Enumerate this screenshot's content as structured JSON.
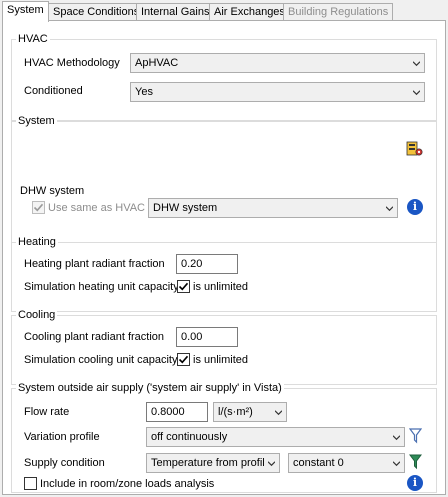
{
  "tabs": [
    {
      "label": "System",
      "active": true,
      "disabled": false
    },
    {
      "label": "Space Conditions",
      "active": false,
      "disabled": false
    },
    {
      "label": "Internal Gains",
      "active": false,
      "disabled": false
    },
    {
      "label": "Air Exchanges",
      "active": false,
      "disabled": false
    },
    {
      "label": "Building Regulations",
      "active": false,
      "disabled": true
    }
  ],
  "hvac": {
    "title": "HVAC",
    "methodology_label": "HVAC Methodology",
    "methodology_value": "ApHVAC",
    "conditioned_label": "Conditioned",
    "conditioned_value": "Yes"
  },
  "system": {
    "title": "System",
    "dhw_label": "DHW system",
    "use_same_label": "Use same as HVAC",
    "use_same_checked": true,
    "dhw_value": "DHW system"
  },
  "heating": {
    "title": "Heating",
    "radiant_label": "Heating plant radiant fraction",
    "radiant_value": "0.20",
    "capacity_label": "Simulation heating unit capacity",
    "unlimited_label": "is unlimited",
    "unlimited_checked": true
  },
  "cooling": {
    "title": "Cooling",
    "radiant_label": "Cooling plant radiant fraction",
    "radiant_value": "0.00",
    "capacity_label": "Simulation cooling unit capacity",
    "unlimited_label": "is unlimited",
    "unlimited_checked": true
  },
  "outside_air": {
    "title": "System outside air supply ('system air supply' in Vista)",
    "flow_rate_label": "Flow rate",
    "flow_rate_value": "0.8000",
    "flow_rate_unit": "l/(s·m²)",
    "variation_label": "Variation profile",
    "variation_value": "off continuously",
    "supply_label": "Supply condition",
    "supply_value": "Temperature from profil",
    "supply_profile_value": "constant 0",
    "include_label": "Include in room/zone loads analysis",
    "include_checked": false
  },
  "icons": {
    "info": "i",
    "info_color": "#1a56c4",
    "filter_inactive_color": "#4a6fb0",
    "filter_active_color": "#2e8b57"
  }
}
